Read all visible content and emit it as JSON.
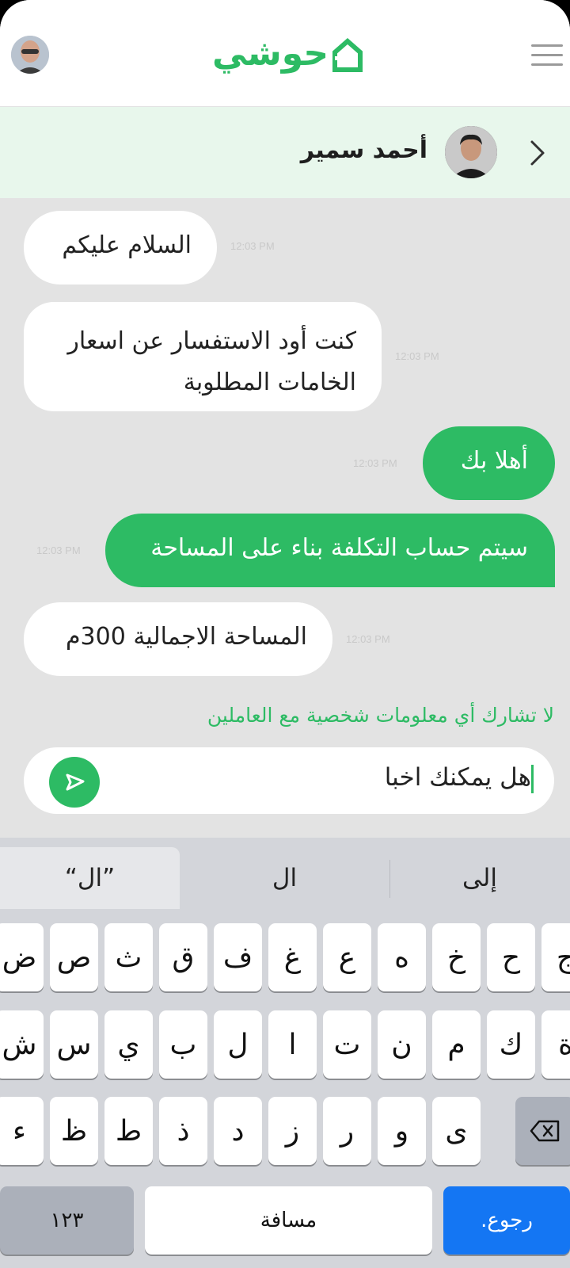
{
  "app": {
    "brand_name": "حوشي",
    "brand_color": "#2dbb64"
  },
  "chat": {
    "contact_name": "أحمد سمير",
    "messages": [
      {
        "side": "in",
        "lines": [
          "السلام عليكم"
        ],
        "time": "12:03 PM"
      },
      {
        "side": "in",
        "lines": [
          "كنت أود الاستفسار عن اسعار",
          "الخامات المطلوبة"
        ],
        "time": "12:03 PM"
      },
      {
        "side": "out",
        "lines": [
          "أهلا بك"
        ],
        "time": "12:03 PM"
      },
      {
        "side": "out",
        "lines": [
          "سيتم حساب التكلفة بناء على المساحة"
        ],
        "time": "12:03 PM"
      },
      {
        "side": "in",
        "lines": [
          "المساحة الاجمالية 300م"
        ],
        "time": "12:03 PM"
      }
    ],
    "privacy_note": "لا تشارك أي معلومات شخصية مع العاملين",
    "composer_value": "هل يمكنك اخبا"
  },
  "keyboard": {
    "suggestions": [
      "إلى",
      "ال",
      "“ال”"
    ],
    "row1": [
      "ج",
      "ح",
      "خ",
      "ه",
      "ع",
      "غ",
      "ف",
      "ق",
      "ث",
      "ص",
      "ض"
    ],
    "row2": [
      "ة",
      "ك",
      "م",
      "ن",
      "ت",
      "ا",
      "ل",
      "ب",
      "ي",
      "س",
      "ش"
    ],
    "row3": [
      "ى",
      "و",
      "ر",
      "ز",
      "د",
      "ذ",
      "ط",
      "ظ",
      "ء"
    ],
    "numbers_key": "١٢٣",
    "space_key": "مسافة",
    "return_key": ".رجوع"
  }
}
